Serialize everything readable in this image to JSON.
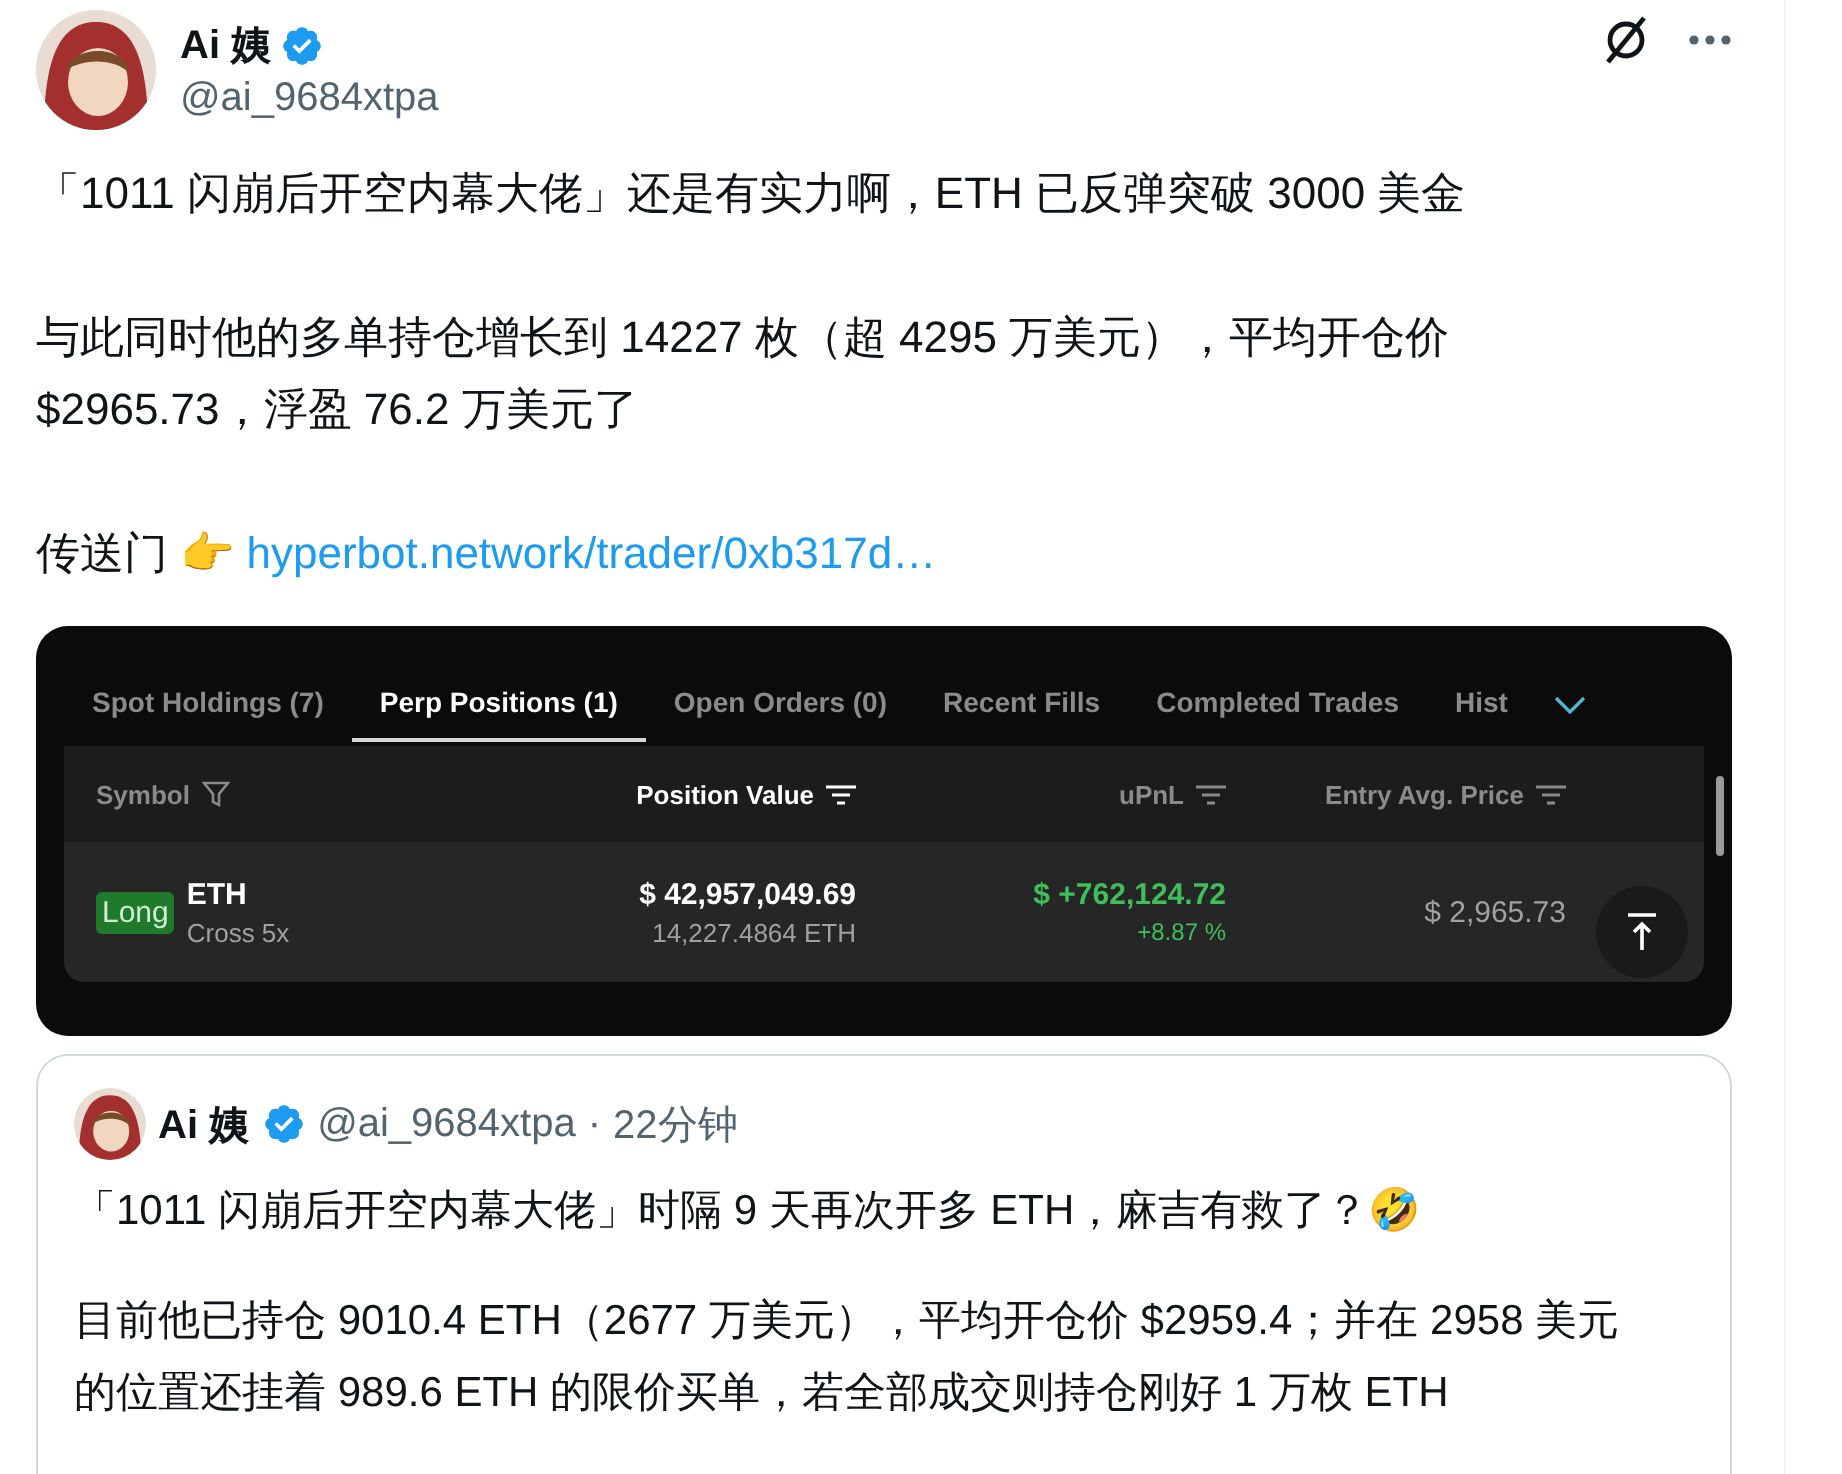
{
  "author": {
    "name": "Ai 姨",
    "handle": "@ai_9684xtpa",
    "verified": true
  },
  "paragraphs": [
    {
      "text": "「1011 闪崩后开空内幕大佬」还是有实力啊，ETH 已反弹突破 3000 美金"
    },
    {
      "text": "与此同时他的多单持仓增长到 14227 枚（超 4295 万美元），平均开仓价 $2965.73，浮盈 76.2 万美元了"
    },
    {
      "text": "传送门 👉 ",
      "link": "hyperbot.network/trader/0xb317d…"
    }
  ],
  "positions_screenshot": {
    "tabs": [
      {
        "label": "Spot Holdings (7)",
        "selected": false
      },
      {
        "label": "Perp Positions (1)",
        "selected": true
      },
      {
        "label": "Open Orders (0)",
        "selected": false
      },
      {
        "label": "Recent Fills",
        "selected": false
      },
      {
        "label": "Completed Trades",
        "selected": false
      },
      {
        "label": "Hist",
        "selected": false
      }
    ],
    "columns": [
      {
        "label": "Symbol",
        "active": false
      },
      {
        "label": "Position Value",
        "active": true
      },
      {
        "label": "uPnL",
        "active": false
      },
      {
        "label": "Entry Avg. Price",
        "active": false
      }
    ],
    "rows": [
      {
        "side": "Long",
        "symbol": "ETH",
        "margin": "Cross 5x",
        "position_value": "$ 42,957,049.69",
        "size": "14,227.4864 ETH",
        "upnl": "$ +762,124.72",
        "upnl_pct": "+8.87 %",
        "entry_price": "$ 2,965.73"
      }
    ]
  },
  "quoted_post": {
    "author": {
      "name": "Ai 姨",
      "handle": "@ai_9684xtpa",
      "verified": true
    },
    "separator": "·",
    "time": "22分钟",
    "paragraphs": [
      {
        "text": "「1011 闪崩后开空内幕大佬」时隔 9 天再次开多 ETH，麻吉有救了？🤣"
      },
      {
        "text": "目前他已持仓 9010.4 ETH（2677 万美元），平均开仓价 $2959.4；并在 2958 美元的位置还挂着 989.6 ETH 的限价买单，若全部成交则持仓刚好 1 万枚 ETH"
      }
    ]
  }
}
